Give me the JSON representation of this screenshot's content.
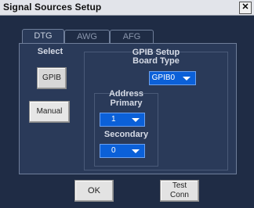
{
  "window": {
    "title": "Signal Sources Setup",
    "close_icon": "close-icon"
  },
  "tabs": [
    {
      "label": "DTG",
      "active": true
    },
    {
      "label": "AWG",
      "active": false
    },
    {
      "label": "AFG",
      "active": false
    }
  ],
  "select": {
    "label": "Select",
    "gpib_button": "GPIB",
    "manual_button": "Manual"
  },
  "gpib_setup": {
    "title": "GPIB Setup",
    "board_type_label": "Board Type",
    "board_type_value": "GPIB0",
    "address_label": "Address",
    "primary_label": "Primary",
    "primary_value": "1",
    "secondary_label": "Secondary",
    "secondary_value": "0"
  },
  "footer": {
    "ok_button": "OK",
    "test_conn_line1": "Test",
    "test_conn_line2": "Conn"
  },
  "colors": {
    "background": "#1f2c45",
    "panel": "#2a3a59",
    "dropdown": "#0b60d8"
  }
}
